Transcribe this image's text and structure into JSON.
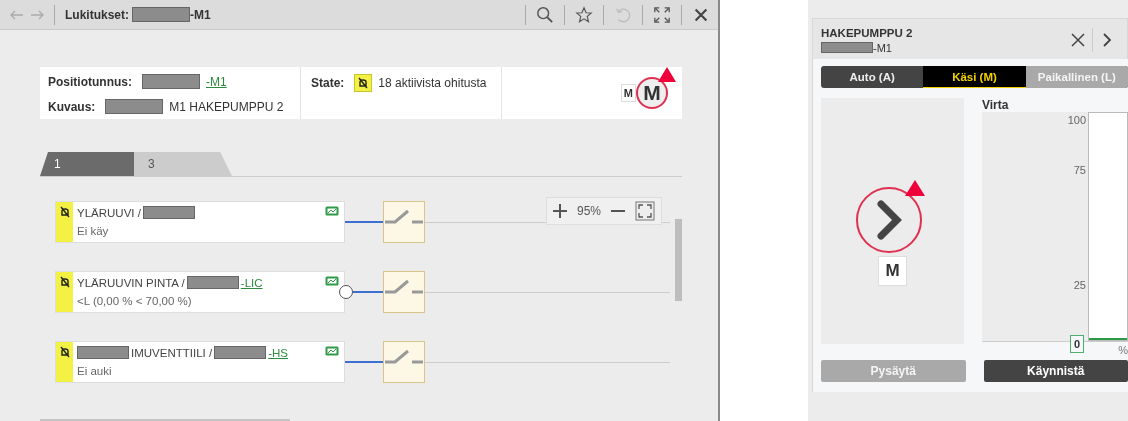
{
  "window": {
    "title_parts": [
      {
        "kind": "text",
        "text": "Lukitukset:"
      },
      {
        "kind": "redacted"
      },
      {
        "kind": "text",
        "text": "-M1"
      }
    ]
  },
  "info": {
    "position_label": "Positiotunnus:",
    "position_parts": [
      {
        "kind": "redacted"
      },
      {
        "kind": "link",
        "text": "-M1"
      }
    ],
    "description_label": "Kuvaus:",
    "description_parts": [
      {
        "kind": "redacted"
      },
      {
        "kind": "text",
        "text": "M1 HAKEPUMPPU 2"
      }
    ],
    "state_label": "State:",
    "state_text": "18 aktiivista ohitusta",
    "mode_small": "M",
    "mode_big": "M"
  },
  "tabs": [
    {
      "label": "1",
      "selected": true
    },
    {
      "label": "3",
      "selected": false
    }
  ],
  "zoom": {
    "reading": "95%"
  },
  "rows": [
    {
      "title_parts": [
        {
          "kind": "text",
          "text": "YLÄRUUVI /"
        },
        {
          "kind": "redacted"
        }
      ],
      "status": "Ei käy",
      "open_circle": false
    },
    {
      "title_parts": [
        {
          "kind": "text",
          "text": "YLÄRUUVIN PINTA /"
        },
        {
          "kind": "redacted"
        },
        {
          "kind": "link",
          "text": "-LIC"
        }
      ],
      "status": "<L (0,00 % < 70,00 %)",
      "open_circle": true
    },
    {
      "title_parts": [
        {
          "kind": "redacted"
        },
        {
          "kind": "text",
          "text": "IMUVENTTIILI /"
        },
        {
          "kind": "redacted"
        },
        {
          "kind": "link",
          "text": "-HS"
        }
      ],
      "status": "Ei auki",
      "open_circle": false
    }
  ],
  "panel": {
    "title": "HAKEPUMPPU 2",
    "subtitle_parts": [
      {
        "kind": "redacted"
      },
      {
        "kind": "text",
        "text": "-M1"
      }
    ],
    "modes": [
      {
        "label": "Auto (A)",
        "selected": false,
        "disabled": false
      },
      {
        "label": "Käsi (M)",
        "selected": true,
        "disabled": false
      },
      {
        "label": "Paikallinen (L)",
        "selected": false,
        "disabled": true
      }
    ],
    "mode_letter": "M",
    "meter": {
      "title": "Virta",
      "ticks": [
        "100",
        "75",
        "25"
      ],
      "level": 0,
      "reading": "0",
      "unit": "%"
    },
    "buttons": [
      {
        "label": "Pysäytä",
        "disabled": true
      },
      {
        "label": "Käynnistä",
        "disabled": false
      }
    ]
  }
}
